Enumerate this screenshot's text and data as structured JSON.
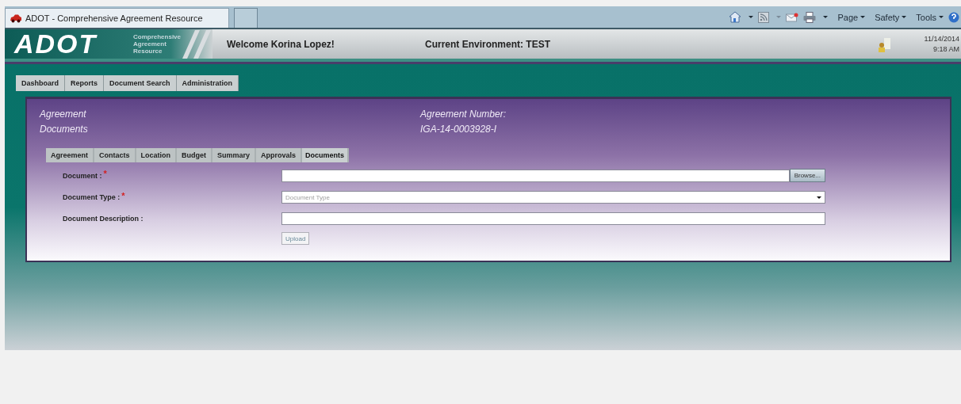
{
  "browser": {
    "tab_title": "ADOT - Comprehensive Agreement Resource",
    "commands": [
      "Page",
      "Safety",
      "Tools"
    ]
  },
  "header": {
    "logo": "ADOT",
    "logo_subtitle": [
      "Comprehensive",
      "Agreement",
      "Resource"
    ],
    "welcome": "Welcome Korina Lopez!",
    "environment": "Current Environment: TEST",
    "date": "11/14/2014",
    "time": "9:18 AM"
  },
  "nav": [
    {
      "label": "Dashboard",
      "selected": false
    },
    {
      "label": "Reports",
      "selected": false
    },
    {
      "label": "Document Search",
      "selected": false
    },
    {
      "label": "Administration",
      "selected": false
    }
  ],
  "panel": {
    "title": [
      "Agreement",
      "Documents"
    ],
    "agreement_label": "Agreement Number:",
    "agreement_number": "IGA-14-0003928-I",
    "tabs": [
      {
        "label": "Agreement",
        "selected": false
      },
      {
        "label": "Contacts",
        "selected": false
      },
      {
        "label": "Location",
        "selected": false
      },
      {
        "label": "Budget",
        "selected": false
      },
      {
        "label": "Summary",
        "selected": false
      },
      {
        "label": "Approvals",
        "selected": false
      },
      {
        "label": "Documents",
        "selected": true
      }
    ],
    "fields": [
      {
        "kind": "file",
        "label": "Document :",
        "required_mark": "*",
        "button": "Browse..."
      },
      {
        "kind": "select",
        "label": "Document Type :",
        "required_mark": "*",
        "placeholder": "Document Type"
      },
      {
        "kind": "text",
        "label": "Document Description :"
      }
    ],
    "upload": "Upload"
  }
}
